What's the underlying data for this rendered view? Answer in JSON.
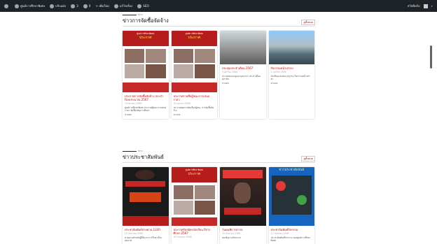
{
  "adminbar": {
    "site": "ศูนย์การศึกษาพิเศษ",
    "customize": "ปรับแต่ง",
    "updates": "3",
    "comments": "0",
    "new": "+ เพิ่มใหม่",
    "edit": "แก้ไขเรื่อง",
    "seo": "SEO",
    "greeting": "สวัสดีครับ"
  },
  "sections": [
    {
      "kicker": "ข่าว",
      "title": "ข่าวการจัดซื้อจัดจ้าง",
      "more": "ดูทั้งหมด",
      "cards": [
        {
          "title": "ประกาศการจัดซื้อจัดจ้าง ประจำปีงบประมาณ 2567",
          "date": "15 ตุลาคม 2566",
          "excerpt": "ศูนย์การศึกษาพิเศษ ประกาศผู้ชนะการเสนอราคา จัดซื้อวัสดุการศึกษา",
          "more": "อ่านต่อ"
        },
        {
          "title": "ประกาศรายชื่อผู้ชนะการเสนอราคา",
          "date": "10 ตุลาคม 2566",
          "excerpt": "ประกาศผลการคัดเลือกผู้ชนะ การจัดซื้อจัดจ้าง",
          "more": "อ่านต่อ"
        },
        {
          "title": "ประชุมประจำเดือน 2567",
          "date": "5 ตุลาคม 2566",
          "excerpt": "ประชุมคณะครูและบุคลากร ประจำเดือนตุลาคม",
          "more": "อ่านต่อ"
        },
        {
          "title": "กิจกรรมหน้าเสาธง",
          "date": "2 ตุลาคม 2566",
          "excerpt": "นักเรียนและคณะครูร่วม กิจกรรมหน้าเสาธง",
          "more": "อ่านต่อ"
        }
      ]
    },
    {
      "kicker": "ข่าว",
      "title": "ข่าวประชาสัมพันธ์",
      "more": "ดูทั้งหมด",
      "cards": [
        {
          "title": "ประชาสัมพันธ์สายด่วน 1330",
          "date": "20 กันยายน 2566",
          "excerpt": "สายด่วนสำหรับผู้ที่ต้องการ ปรึกษาเรื่องสุขภาพ",
          "more": "อ่านต่อ"
        },
        {
          "title": "ประกาศรับสมัครนักเรียน ปีการศึกษา 2567",
          "date": "18 กันยายน 2566",
          "excerpt": "",
          "more": "อ่านต่อ"
        },
        {
          "title": "วันคนพิการสากล",
          "date": "15 กันยายน 2566",
          "excerpt": "ขอเชิญร่วมกิจกรรม",
          "more": "อ่านต่อ"
        },
        {
          "title": "ประชาสัมพันธ์กิจกรรม",
          "date": "12 กันยายน 2566",
          "excerpt": "ประชาสัมพันธ์กิจกรรม ของศูนย์การศึกษาพิเศษ",
          "more": "อ่านต่อ"
        }
      ]
    }
  ],
  "thumbs": {
    "poster_head": "ศูนย์การศึกษาพิเศษ",
    "poster_big": "ประกาศ",
    "news_big": "ข่าวประชาสัมพันธ์"
  }
}
